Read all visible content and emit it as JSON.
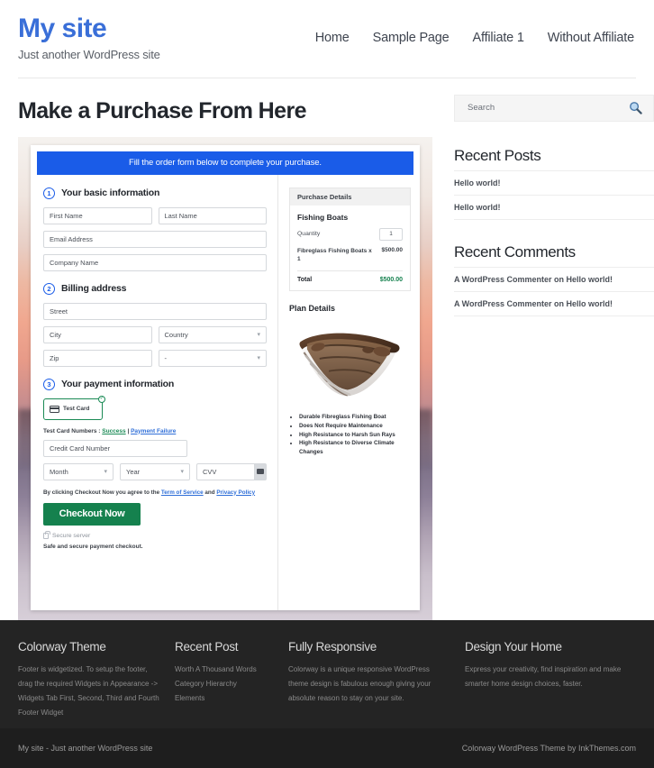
{
  "header": {
    "brand_title": "My site",
    "brand_tagline": "Just another WordPress site",
    "nav": [
      {
        "label": "Home"
      },
      {
        "label": "Sample Page"
      },
      {
        "label": "Affiliate 1"
      },
      {
        "label": "Without Affiliate"
      }
    ]
  },
  "main": {
    "page_title": "Make a Purchase From Here",
    "checkout": {
      "banner": "Fill the order form below to complete your purchase.",
      "step1": {
        "number": "1",
        "title": "Your basic information",
        "first_name_placeholder": "First Name",
        "last_name_placeholder": "Last Name",
        "email_placeholder": "Email Address",
        "company_placeholder": "Company Name"
      },
      "step2": {
        "number": "2",
        "title": "Billing address",
        "street_placeholder": "Street",
        "city_placeholder": "City",
        "country_placeholder": "Country",
        "zip_placeholder": "Zip",
        "state_placeholder": "-"
      },
      "step3": {
        "number": "3",
        "title": "Your payment information",
        "method_label": "Test Card",
        "method_selected_icon": "check-circle-icon",
        "test_card_prefix": "Test Card Numbers : ",
        "test_card_success": "Success",
        "test_card_separator": " | ",
        "test_card_failure": "Payment Failure",
        "card_number_placeholder": "Credit Card Number",
        "month_placeholder": "Month",
        "year_placeholder": "Year",
        "cvv_placeholder": "CVV",
        "terms_prefix": "By clicking Checkout Now you agree to the ",
        "terms_link1": "Term of Service",
        "terms_and": " and ",
        "terms_link2": "Privacy Policy",
        "checkout_button": "Checkout Now",
        "secure_server": "Secure server",
        "safe_note": "Safe and secure payment checkout."
      },
      "purchase_details": {
        "panel_title": "Purchase Details",
        "item_name": "Fishing Boats",
        "quantity_label": "Quantity",
        "quantity_value": "1",
        "line_item_name": "Fibreglass Fishing Boats x 1",
        "line_item_price": "$500.00",
        "total_label": "Total",
        "total_value": "$500.00"
      },
      "plan_details": {
        "title": "Plan Details",
        "image_alt": "fishing-boat-photo",
        "features": [
          "Durable Fibreglass Fishing Boat",
          "Does Not Require Maintenance",
          "High Resistance to Harsh Sun Rays",
          "High Resistance to Diverse Climate Changes"
        ]
      }
    }
  },
  "sidebar": {
    "search": {
      "placeholder": "Search",
      "icon": "search-icon"
    },
    "recent_posts": {
      "title": "Recent Posts",
      "items": [
        "Hello world!",
        "Hello world!"
      ]
    },
    "recent_comments": {
      "title": "Recent Comments",
      "items": [
        "A WordPress Commenter on Hello world!",
        "A WordPress Commenter on Hello world!"
      ]
    }
  },
  "footer": {
    "columns": [
      {
        "title": "Colorway Theme",
        "text": "Footer is widgetized. To setup the footer, drag the required Widgets in Appearance -> Widgets Tab First, Second, Third and Fourth Footer Widget"
      },
      {
        "title": "Recent Post",
        "items": [
          "Worth A Thousand Words",
          "Category Hierarchy",
          "Elements"
        ]
      },
      {
        "title": "Fully Responsive",
        "text": "Colorway is a unique responsive WordPress theme design is fabulous enough giving your absolute reason to stay on your site."
      },
      {
        "title": "Design Your Home",
        "text": "Express your creativity, find inspiration and make smarter home design choices, faster."
      }
    ],
    "bottom_left": "My site - Just another WordPress site",
    "bottom_right": "Colorway WordPress Theme by InkThemes.com"
  },
  "colors": {
    "brand_blue": "#3a6fd8",
    "banner_blue": "#1a5ce8",
    "green": "#15814e",
    "footer_dark": "#242424"
  }
}
